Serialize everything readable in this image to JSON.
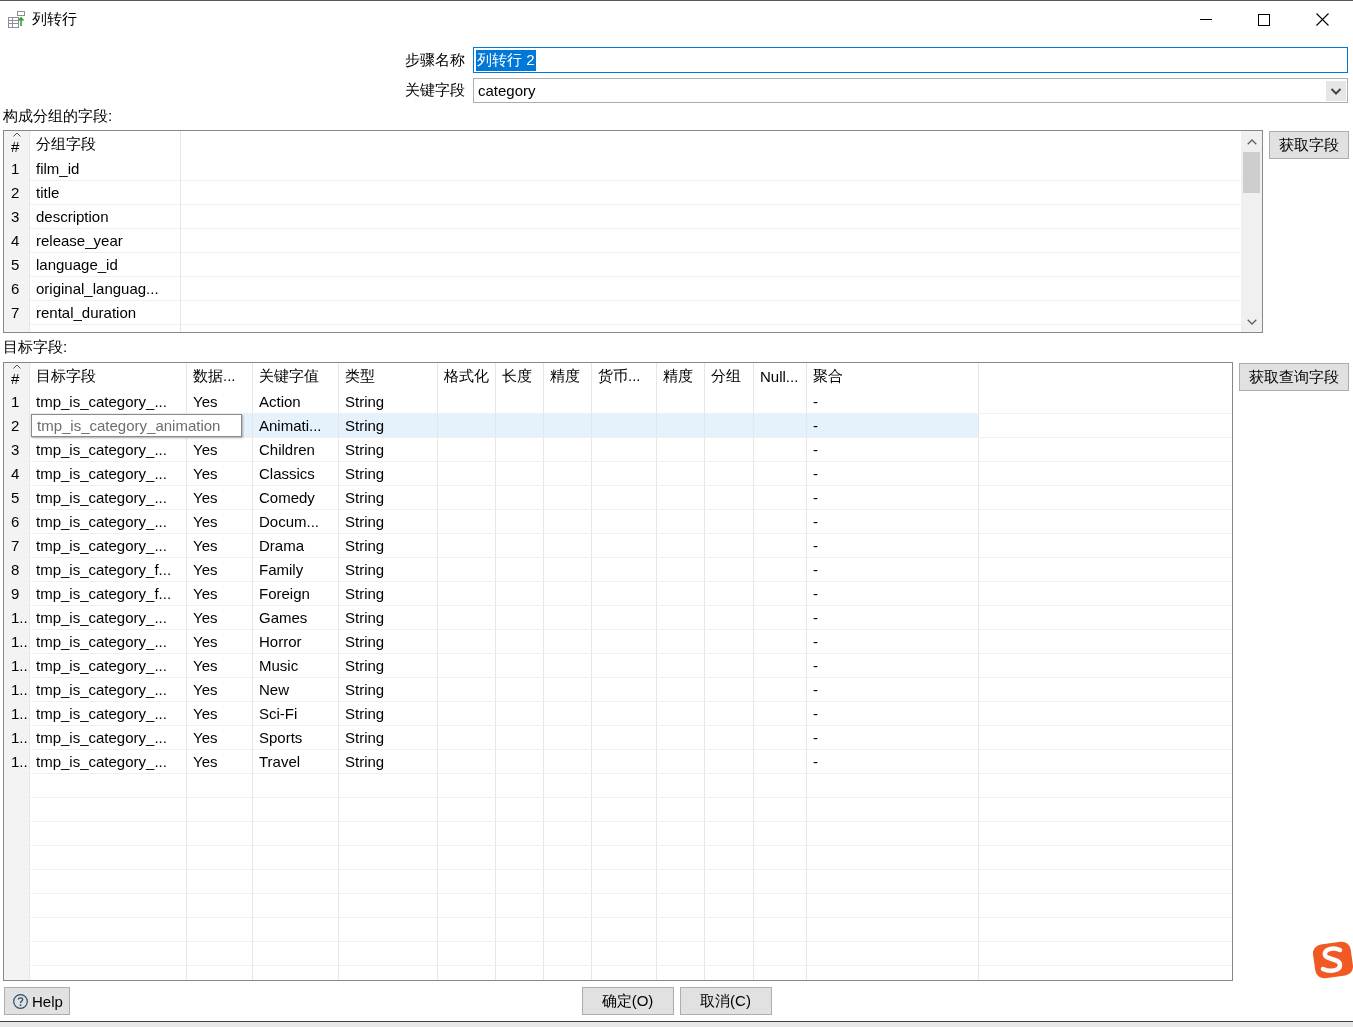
{
  "window": {
    "title": "列转行"
  },
  "form": [
    {
      "kind": "text",
      "label": "步骤名称",
      "value": "列转行 2",
      "focused": true
    },
    {
      "kind": "dropdown",
      "label": "关键字段",
      "value": "category",
      "focused": false
    }
  ],
  "group_fields": {
    "label": "构成分组的字段:",
    "columns": [
      "#",
      "分组字段"
    ],
    "rows": [
      {
        "number": "1",
        "name": "film_id"
      },
      {
        "number": "2",
        "name": "title"
      },
      {
        "number": "3",
        "name": "description"
      },
      {
        "number": "4",
        "name": "release_year"
      },
      {
        "number": "5",
        "name": "language_id"
      },
      {
        "number": "6",
        "name": "original_languag..."
      },
      {
        "number": "7",
        "name": "rental_duration"
      }
    ],
    "button": "获取字段"
  },
  "target_fields": {
    "label": "目标字段:",
    "columns": [
      "#",
      "目标字段",
      "数据...",
      "关键字值",
      "类型",
      "格式化",
      "长度",
      "精度",
      "货币...",
      "精度",
      "分组",
      "Null...",
      "聚合"
    ],
    "rows": [
      {
        "number": "1",
        "target_field": "tmp_is_category_...",
        "column_3": "Yes",
        "key_value": "Action",
        "type": "String",
        "aggregation": "-",
        "selected": false
      },
      {
        "number": "2",
        "tooltip": "tmp_is_category_animation",
        "key_value": "Animati...",
        "type": "String",
        "aggregation": "-",
        "selected": true
      },
      {
        "number": "3",
        "target_field": "tmp_is_category_...",
        "column_3": "Yes",
        "key_value": "Children",
        "type": "String",
        "aggregation": "-",
        "selected": false
      },
      {
        "number": "4",
        "target_field": "tmp_is_category_...",
        "column_3": "Yes",
        "key_value": "Classics",
        "type": "String",
        "aggregation": "-",
        "selected": false
      },
      {
        "number": "5",
        "target_field": "tmp_is_category_...",
        "column_3": "Yes",
        "key_value": "Comedy",
        "type": "String",
        "aggregation": "-",
        "selected": false
      },
      {
        "number": "6",
        "target_field": "tmp_is_category_...",
        "column_3": "Yes",
        "key_value": "Docum...",
        "type": "String",
        "aggregation": "-",
        "selected": false
      },
      {
        "number": "7",
        "target_field": "tmp_is_category_...",
        "column_3": "Yes",
        "key_value": "Drama",
        "type": "String",
        "aggregation": "-",
        "selected": false
      },
      {
        "number": "8",
        "target_field": "tmp_is_category_f...",
        "column_3": "Yes",
        "key_value": "Family",
        "type": "String",
        "aggregation": "-",
        "selected": false
      },
      {
        "number": "9",
        "target_field": "tmp_is_category_f...",
        "column_3": "Yes",
        "key_value": "Foreign",
        "type": "String",
        "aggregation": "-",
        "selected": false
      },
      {
        "number": "1..",
        "target_field": "tmp_is_category_...",
        "column_3": "Yes",
        "key_value": "Games",
        "type": "String",
        "aggregation": "-",
        "selected": false
      },
      {
        "number": "1..",
        "target_field": "tmp_is_category_...",
        "column_3": "Yes",
        "key_value": "Horror",
        "type": "String",
        "aggregation": "-",
        "selected": false
      },
      {
        "number": "1..",
        "target_field": "tmp_is_category_...",
        "column_3": "Yes",
        "key_value": "Music",
        "type": "String",
        "aggregation": "-",
        "selected": false
      },
      {
        "number": "1..",
        "target_field": "tmp_is_category_...",
        "column_3": "Yes",
        "key_value": "New",
        "type": "String",
        "aggregation": "-",
        "selected": false
      },
      {
        "number": "1..",
        "target_field": "tmp_is_category_...",
        "column_3": "Yes",
        "key_value": "Sci-Fi",
        "type": "String",
        "aggregation": "-",
        "selected": false
      },
      {
        "number": "1..",
        "target_field": "tmp_is_category_...",
        "column_3": "Yes",
        "key_value": "Sports",
        "type": "String",
        "aggregation": "-",
        "selected": false
      },
      {
        "number": "1..",
        "target_field": "tmp_is_category_...",
        "column_3": "Yes",
        "key_value": "Travel",
        "type": "String",
        "aggregation": "-",
        "selected": false
      }
    ],
    "button": "获取查询字段"
  },
  "footer": {
    "help": "Help",
    "buttons": [
      "确定(O)",
      "取消(C)"
    ]
  }
}
